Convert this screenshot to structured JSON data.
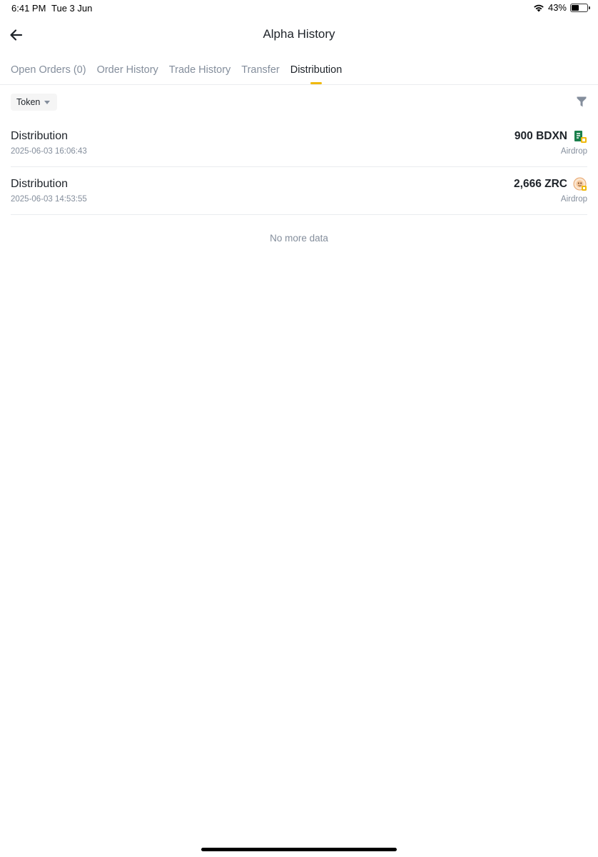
{
  "status_bar": {
    "time": "6:41 PM",
    "date": "Tue 3 Jun",
    "battery_percent": "43%",
    "battery_level": 0.43
  },
  "header": {
    "title": "Alpha History",
    "back_icon": "arrow-left-icon"
  },
  "tabs": [
    {
      "label": "Open Orders (0)",
      "active": false
    },
    {
      "label": "Order History",
      "active": false
    },
    {
      "label": "Trade History",
      "active": false
    },
    {
      "label": "Transfer",
      "active": false
    },
    {
      "label": "Distribution",
      "active": true
    }
  ],
  "filter": {
    "token_label": "Token",
    "filter_icon": "funnel-icon"
  },
  "records": [
    {
      "title": "Distribution",
      "time": "2025-06-03 16:06:43",
      "amount": "900 BDXN",
      "type": "Airdrop",
      "token_icon": "bdxn-token-icon"
    },
    {
      "title": "Distribution",
      "time": "2025-06-03 14:53:55",
      "amount": "2,666 ZRC",
      "type": "Airdrop",
      "token_icon": "zrc-token-icon"
    }
  ],
  "footer_text": "No more data",
  "colors": {
    "accent": "#f0b90b",
    "primary_text": "#1e2329",
    "secondary_text": "#848e9c"
  }
}
